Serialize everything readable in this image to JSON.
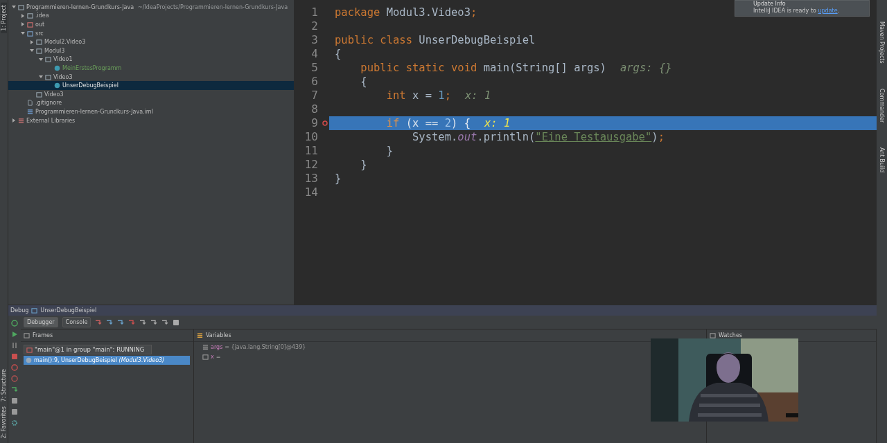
{
  "left_strip": {
    "top_tabs": [
      {
        "label": "1: Project",
        "selected": true
      }
    ],
    "bottom_tabs": [
      {
        "label": "7: Structure",
        "selected": false
      },
      {
        "label": "2: Favorites",
        "selected": false
      }
    ]
  },
  "project_tree": {
    "root": {
      "label": "Programmieren-lernen-Grundkurs-Java",
      "path": "~/IdeaProjects/Programmieren-lernen-Grundkurs-Java",
      "kind": "module",
      "expanded": true,
      "selected": false,
      "children": [
        {
          "label": ".idea",
          "kind": "folder",
          "expanded": false,
          "selected": false
        },
        {
          "label": "out",
          "kind": "excluded",
          "expanded": false,
          "selected": false
        },
        {
          "label": "src",
          "kind": "source",
          "expanded": true,
          "selected": false,
          "children": [
            {
              "label": "Modul2.Video3",
              "kind": "package",
              "expanded": false,
              "selected": false
            },
            {
              "label": "Modul3",
              "kind": "package",
              "expanded": true,
              "selected": false,
              "children": [
                {
                  "label": "Video1",
                  "kind": "package",
                  "expanded": true,
                  "selected": false,
                  "children": [
                    {
                      "label": "MeinErstesProgramm",
                      "kind": "class",
                      "selected": false,
                      "modified": true
                    }
                  ]
                },
                {
                  "label": "Video3",
                  "kind": "package",
                  "expanded": true,
                  "selected": false,
                  "children": [
                    {
                      "label": "UnserDebugBeispiel",
                      "kind": "class",
                      "selected": true,
                      "modified": false
                    }
                  ]
                }
              ]
            },
            {
              "label": "Video3",
              "kind": "package",
              "selected": false
            }
          ]
        },
        {
          "label": ".gitignore",
          "kind": "file",
          "selected": false
        },
        {
          "label": "Programmieren-lernen-Grundkurs-Java.iml",
          "kind": "iml",
          "selected": false
        }
      ]
    },
    "libraries": {
      "label": "External Libraries",
      "expanded": false,
      "selected": false
    }
  },
  "notification": {
    "title": "Update Info",
    "text": "IntelliJ IDEA is ready to",
    "link": "update",
    "after": "."
  },
  "editor": {
    "lines": [
      {
        "number": "1",
        "tokens": [
          {
            "kind": "keyword",
            "text": "package "
          },
          {
            "kind": "plain",
            "text": "Modul3.Video3"
          },
          {
            "kind": "keyword",
            "text": ";"
          }
        ]
      },
      {
        "number": "2"
      },
      {
        "number": "3",
        "tokens": [
          {
            "kind": "keyword",
            "text": "public class "
          },
          {
            "kind": "plain",
            "text": "UnserDebugBeispiel"
          }
        ]
      },
      {
        "number": "4",
        "tokens": [
          {
            "kind": "plain",
            "text": "{"
          }
        ]
      },
      {
        "number": "5",
        "tokens": [
          {
            "kind": "keyword",
            "text": "    public static void "
          },
          {
            "kind": "plain",
            "text": "main(String[] args)"
          },
          {
            "kind": "hint",
            "text": "args: {}"
          }
        ]
      },
      {
        "number": "6",
        "tokens": [
          {
            "kind": "plain",
            "text": "    {"
          }
        ]
      },
      {
        "number": "7",
        "tokens": [
          {
            "kind": "keyword",
            "text": "        int "
          },
          {
            "kind": "plain",
            "text": "x = "
          },
          {
            "kind": "number",
            "text": "1"
          },
          {
            "kind": "keyword",
            "text": ";"
          },
          {
            "kind": "hint",
            "text": "x: 1"
          }
        ]
      },
      {
        "number": "8"
      },
      {
        "number": "9",
        "breakpoint": true,
        "current": true,
        "tokens": [
          {
            "kind": "keyword",
            "text": "        if "
          },
          {
            "kind": "plain",
            "text": "(x == "
          },
          {
            "kind": "number",
            "text": "2"
          },
          {
            "kind": "plain",
            "text": ") {"
          },
          {
            "kind": "hint",
            "text": "x: 1"
          }
        ]
      },
      {
        "number": "10",
        "tokens": [
          {
            "kind": "plain",
            "text": "            System."
          },
          {
            "kind": "field",
            "text": "out"
          },
          {
            "kind": "plain",
            "text": ".println("
          },
          {
            "kind": "string",
            "text": "\"Eine Testausgabe\""
          },
          {
            "kind": "plain",
            "text": ")"
          },
          {
            "kind": "keyword",
            "text": ";"
          }
        ]
      },
      {
        "number": "11",
        "tokens": [
          {
            "kind": "plain",
            "text": "        }"
          }
        ]
      },
      {
        "number": "12",
        "tokens": [
          {
            "kind": "plain",
            "text": "    }"
          }
        ]
      },
      {
        "number": "13",
        "tokens": [
          {
            "kind": "plain",
            "text": "}"
          }
        ]
      },
      {
        "number": "14"
      }
    ]
  },
  "right_strip": {
    "tabs": [
      {
        "label": "Maven Projects",
        "selected": false
      },
      {
        "label": "Commander",
        "selected": false
      },
      {
        "label": "Ant Build",
        "selected": false
      }
    ]
  },
  "debug": {
    "title": "Debug",
    "config": "UnserDebugBeispiel",
    "tabs": [
      {
        "label": "Debugger",
        "selected": true
      },
      {
        "label": "Console",
        "selected": false
      }
    ],
    "frames": {
      "title": "Frames",
      "thread": "\"main\"@1 in group \"main\": RUNNING",
      "items": [
        {
          "label": "main():9, UnserDebugBeispiel *(Modul3.Video3)*",
          "selected": true
        }
      ]
    },
    "variables": {
      "title": "Variables",
      "items": [
        {
          "kind": "array",
          "name": "args",
          "value": "= {java.lang.String[0]@439}"
        },
        {
          "kind": "primitive",
          "name": "x",
          "value": "="
        }
      ]
    },
    "watches": {
      "title": "Watches"
    }
  }
}
